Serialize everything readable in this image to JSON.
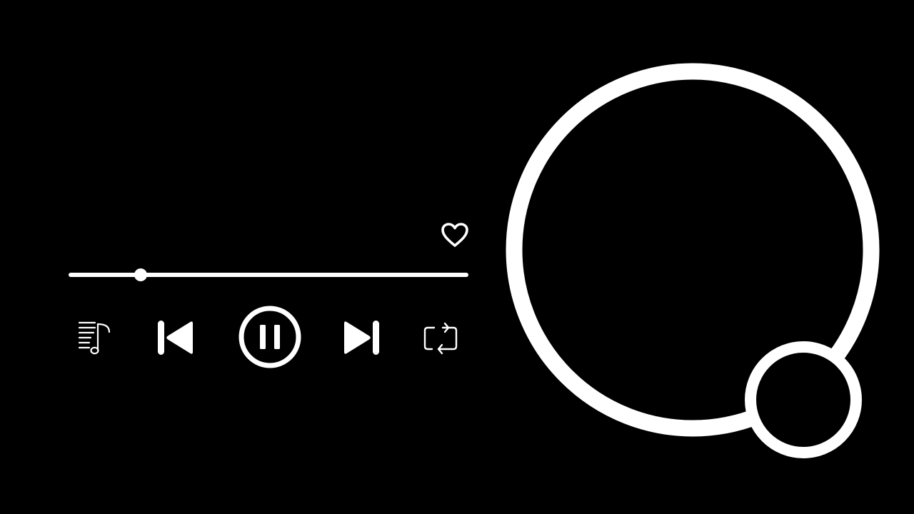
{
  "player": {
    "progress_fraction": 0.18,
    "liked": false,
    "state": "playing"
  },
  "icons": {
    "like": "heart-outline-icon",
    "playlist": "music-queue-icon",
    "previous": "skip-previous-icon",
    "pause": "pause-icon",
    "next": "skip-next-icon",
    "repeat": "repeat-icon"
  },
  "colors": {
    "background": "#000000",
    "foreground": "#ffffff"
  }
}
